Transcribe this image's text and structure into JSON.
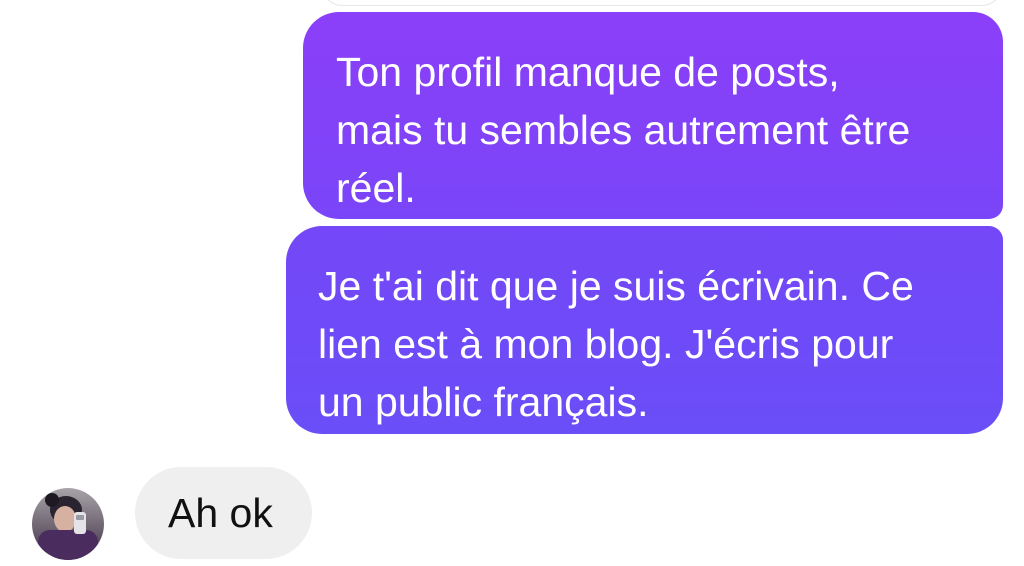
{
  "conversation": {
    "messages": [
      {
        "sender": "me",
        "text": "Ton profil manque de posts,\nmais tu sembles autrement être\nréel."
      },
      {
        "sender": "me",
        "text": "Je t'ai dit que je suis écrivain. Ce\nlien est à mon blog. J'écris pour\nun public français."
      },
      {
        "sender": "contact",
        "text": "Ah ok"
      }
    ]
  },
  "colors": {
    "outgoing_top": "#8b3ff8",
    "outgoing_bottom": "#6a4ef8",
    "incoming_bg": "#efefef",
    "page_bg": "#ffffff"
  },
  "icons": {
    "contact_avatar": "avatar-photo"
  }
}
